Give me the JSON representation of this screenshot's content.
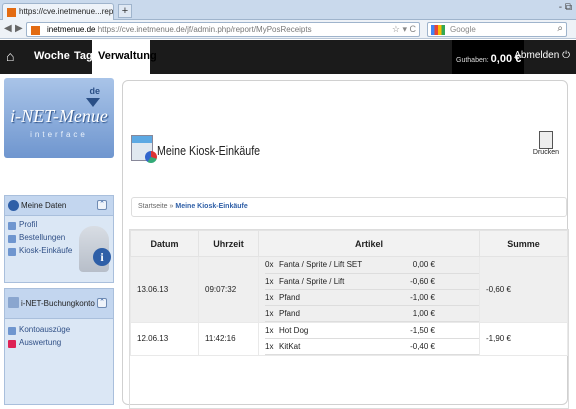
{
  "browser": {
    "tab_title": "https://cve.inetmenue...report/MyPosReceipts",
    "new_tab": "+",
    "window_controls": "- ⧉",
    "url_host": "inetmenue.de",
    "url_rest": "https://cve.inetmenue.de/jf/admin.php/report/MyPosReceipts",
    "search_placeholder": "Google",
    "search_engine_icon": "google-icon"
  },
  "appbar": {
    "home_icon": "home-icon",
    "menu": [
      "Woche",
      "Tag",
      "Verwaltung"
    ],
    "guthaben_label": "Guthaben:",
    "guthaben_value": "0,00 €",
    "logout": "Abmelden"
  },
  "sidebar": {
    "logo_main": "i-NET-Menue",
    "logo_sub": "interface",
    "logo_lang": "de",
    "panel1": {
      "title": "Meine Daten",
      "items": [
        "Profil",
        "Bestellungen",
        "Kiosk-Einkäufe"
      ]
    },
    "panel2": {
      "title": "i-NET-Buchungkonto",
      "items": [
        "Kontoauszüge",
        "Auswertung"
      ]
    }
  },
  "main": {
    "title": "Meine Kiosk-Einkäufe",
    "print_label": "Drucken",
    "breadcrumb_home": "Startseite",
    "breadcrumb_sep": "»",
    "breadcrumb_current": "Meine Kiosk-Einkäufe",
    "columns": [
      "Datum",
      "Uhrzeit",
      "Artikel",
      "Summe"
    ],
    "rows": [
      {
        "datum": "13.06.13",
        "uhrzeit": "09:07:32",
        "summe": "-0,60 €",
        "items": [
          {
            "qty": "0x",
            "name": "Fanta / Sprite / Lift SET",
            "price": "0,00 €"
          },
          {
            "qty": "1x",
            "name": "Fanta / Sprite / Lift",
            "price": "-0,60 €"
          },
          {
            "qty": "1x",
            "name": "Pfand",
            "price": "-1,00 €"
          },
          {
            "qty": "1x",
            "name": "Pfand",
            "price": "1,00 €"
          }
        ]
      },
      {
        "datum": "12.06.13",
        "uhrzeit": "11:42:16",
        "summe": "-1,90 €",
        "items": [
          {
            "qty": "1x",
            "name": "Hot Dog",
            "price": "-1,50 €"
          },
          {
            "qty": "1x",
            "name": "KitKat",
            "price": "-0,40 €"
          }
        ]
      }
    ]
  }
}
